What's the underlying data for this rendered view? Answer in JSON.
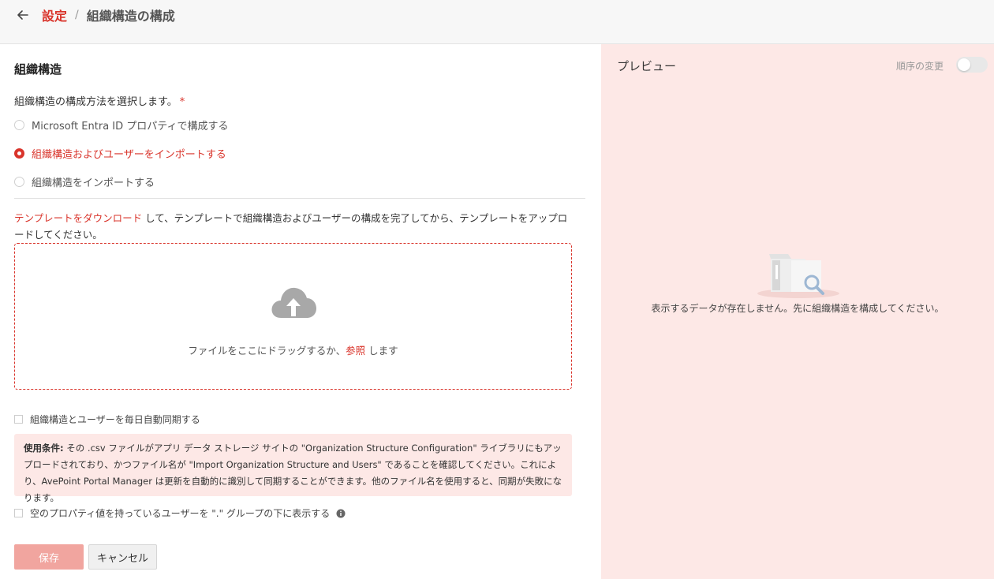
{
  "header": {
    "root": "設定",
    "separator": "/",
    "current": "組織構造の構成"
  },
  "section_title": "組織構造",
  "method": {
    "label": "組織構造の構成方法を選択します。",
    "required_mark": "*",
    "options": [
      {
        "label": "Microsoft Entra ID プロパティで構成する",
        "selected": false
      },
      {
        "label": "組織構造およびユーザーをインポートする",
        "selected": true
      },
      {
        "label": "組織構造をインポートする",
        "selected": false
      }
    ]
  },
  "instruction": {
    "link": "テンプレートをダウンロード",
    "text": " して、テンプレートで組織構造およびユーザーの構成を完了してから、テンプレートをアップロードしてください。"
  },
  "dropzone": {
    "icon": "cloud-upload-icon",
    "text_before": "ファイルをここにドラッグするか、",
    "link": "参照",
    "text_after": " します"
  },
  "auto_sync": {
    "label": "組織構造とユーザーを毎日自動同期する",
    "checked": false
  },
  "notice": {
    "title": "使用条件:",
    "body": " その .csv ファイルがアプリ データ ストレージ サイトの \"Organization Structure Configuration\" ライブラリにもアップロードされており、かつファイル名が \"Import Organization Structure and Users\" であることを確認してください。これにより、AvePoint Portal Manager は更新を自動的に識別して同期することができます。他のファイル名を使用すると、同期が失敗になります。"
  },
  "empty_property": {
    "label": "空のプロパティ値を持っているユーザーを \".\" グループの下に表示する",
    "checked": false,
    "icon": "info-icon"
  },
  "buttons": {
    "save": "保存",
    "cancel": "キャンセル"
  },
  "preview": {
    "title": "プレビュー",
    "order_label": "順序の変更",
    "order_toggle": false,
    "empty_text": "表示するデータが存在しません。先に組織構造を構成してください。"
  },
  "colors": {
    "accent": "#d9342b",
    "panel_bg": "#fde8e6",
    "save_disabled": "#f1a59f"
  }
}
